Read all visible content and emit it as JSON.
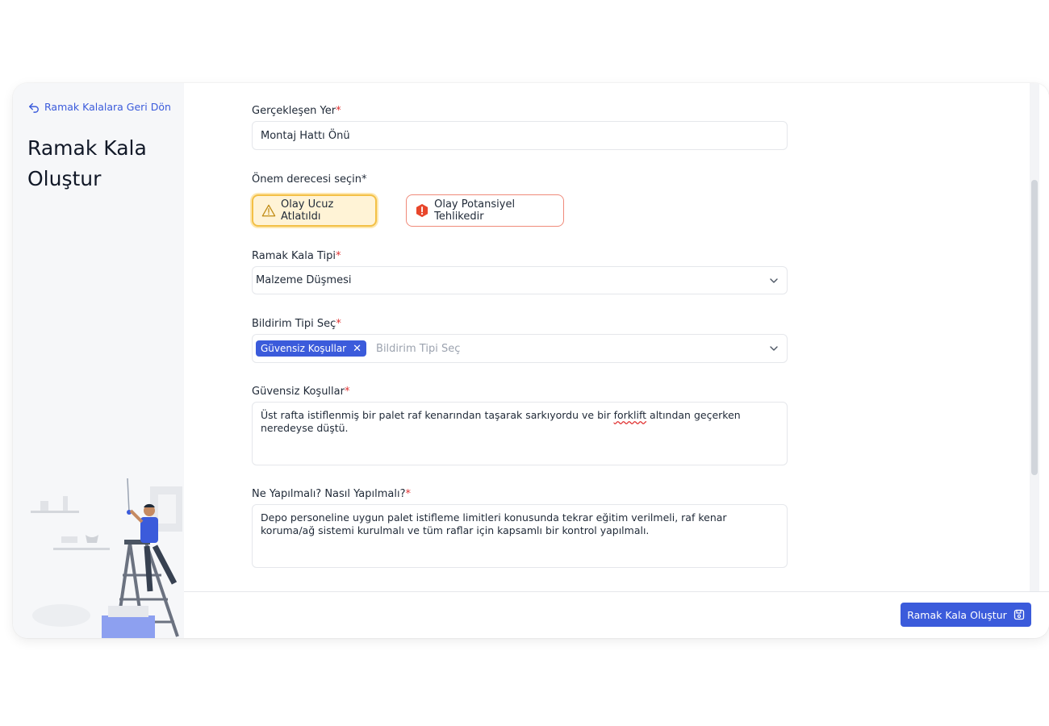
{
  "sidebar": {
    "back_label": "Ramak Kalalara Geri Dön",
    "title": "Ramak Kala Oluştur"
  },
  "form": {
    "location": {
      "label": "Gerçekleşen Yer",
      "required_mark": "*",
      "value": "Montaj Hattı Önü"
    },
    "severity": {
      "label": "Önem derecesi seçin*",
      "options": [
        {
          "label": "Olay Ucuz Atlatıldı",
          "icon": "warning-triangle-icon",
          "selected": true
        },
        {
          "label": "Olay Potansiyel Tehlikedir",
          "icon": "danger-octagon-icon",
          "selected": false
        }
      ]
    },
    "type": {
      "label": "Ramak Kala Tipi",
      "required_mark": "*",
      "value": "Malzeme Düşmesi"
    },
    "notification": {
      "label": "Bildirim Tipi Seç",
      "required_mark": "*",
      "chip": "Güvensiz Koşullar",
      "chip_close": "✕",
      "placeholder": "Bildirim Tipi Seç"
    },
    "unsafe": {
      "label": "Güvensiz Koşullar",
      "required_mark": "*",
      "value_before": "Üst rafta istiflenmiş bir palet raf kenarından taşarak sarkıyordu ve bir ",
      "value_flagged": "forklift",
      "value_after": " altından geçerken neredeyse düştü."
    },
    "action": {
      "label": "Ne Yapılmalı? Nasıl Yapılmalı?",
      "required_mark": "*",
      "value": "Depo personeline uygun palet istifleme limitleri konusunda tekrar eğitim verilmeli, raf kenar koruma/ağ sistemi kurulmalı ve tüm raflar için kapsamlı bir kontrol yapılmalı."
    }
  },
  "footer": {
    "submit_label": "Ramak Kala Oluştur"
  },
  "colors": {
    "primary": "#3b5bdb",
    "required": "#e03131",
    "warning_bg": "#fff3d6",
    "danger": "#e8462b"
  }
}
